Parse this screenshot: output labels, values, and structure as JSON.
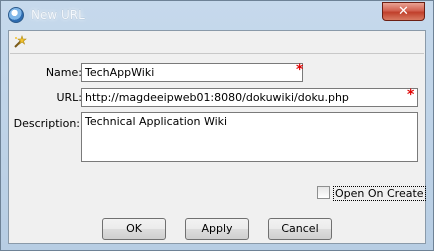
{
  "window": {
    "title": "New URL",
    "close_label": "✕"
  },
  "toolbar": {
    "icon": "wizard-icon"
  },
  "form": {
    "name_label": "Name:",
    "name_value": "TechAppWiki",
    "url_label": "URL:",
    "url_value": "http://magdeeipweb01:8080/dokuwiki/doku.php",
    "description_label": "Description:",
    "description_value": "Technical Application Wiki",
    "required_marker": "*"
  },
  "options": {
    "open_on_create_label": "Open On Create",
    "open_on_create_checked": false
  },
  "buttons": {
    "ok": "OK",
    "apply": "Apply",
    "cancel": "Cancel"
  },
  "colors": {
    "title_bar": "#b7cde3",
    "close_button": "#c0402b",
    "required": "#e00000"
  }
}
